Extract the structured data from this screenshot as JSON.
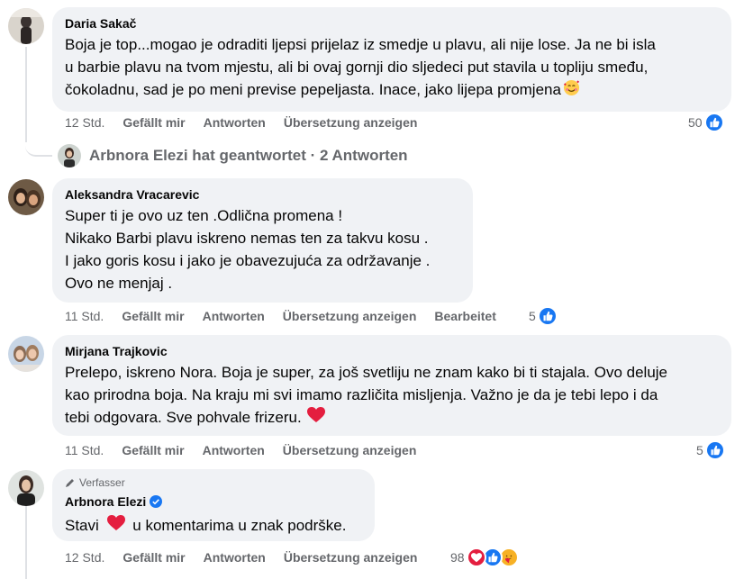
{
  "comments": [
    {
      "author": "Daria Sakač",
      "lines": [
        "Boja je top...mogao je odraditi ljepsi prijelaz iz smedje u plavu, ali nije lose. Ja ne bi isla",
        "u barbie plavu na tvom mjestu, ali bi ovaj gornji dio sljedeci put stavila u topliju smeđu,",
        "čokoladnu, sad je po meni previse pepeljasta. Inace, jako lijepa promjena"
      ],
      "emoji": "smiling-face-with-hearts",
      "time": "12 Std.",
      "like": "Gefällt mir",
      "reply": "Antworten",
      "translate": "Übersetzung anzeigen",
      "reactions": "50",
      "reaction_icons": [
        "like-icon"
      ]
    },
    {
      "author": "Aleksandra Vracarevic",
      "lines": [
        "Super ti je ovo uz ten .Odlična promena !",
        "Nikako Barbi plavu iskreno nemas ten za takvu kosu .",
        "I jako goris kosu i jako je obavezujuća za održavanje .",
        "Ovo ne menjaj ."
      ],
      "time": "11 Std.",
      "like": "Gefällt mir",
      "reply": "Antworten",
      "translate": "Übersetzung anzeigen",
      "edited": "Bearbeitet",
      "reactions": "5",
      "reaction_icons": [
        "like-icon"
      ]
    },
    {
      "author": "Mirjana Trajkovic",
      "lines": [
        "Prelepo, iskreno Nora. Boja je super, za još svetliju ne znam kako bi ti stajala. Ovo deluje",
        "kao prirodna boja. Na kraju mi svi imamo različita misljenja. Važno je da je tebi lepo i da",
        "tebi odgovara. Sve pohvale frizeru."
      ],
      "emoji": "red-heart",
      "time": "11 Std.",
      "like": "Gefällt mir",
      "reply": "Antworten",
      "translate": "Übersetzung anzeigen",
      "reactions": "5",
      "reaction_icons": [
        "like-icon"
      ]
    },
    {
      "badge": "Verfasser",
      "author": "Arbnora Elezi",
      "verified": true,
      "text_before": "Stavi",
      "text_after": "u komentarima u znak podrške.",
      "emoji": "red-heart",
      "time": "12 Std.",
      "like": "Gefällt mir",
      "reply": "Antworten",
      "translate": "Übersetzung anzeigen",
      "reactions": "98",
      "reaction_icons": [
        "love-icon",
        "like-icon",
        "care-icon"
      ]
    }
  ],
  "replies_link": "Arbnora Elezi hat geantwortet · 2 Antworten",
  "colors": {
    "bubble": "#f0f2f5",
    "meta": "#65676b",
    "like_blue": "#1877f2",
    "heart": "#e41e3f",
    "care": "#f7b125"
  }
}
